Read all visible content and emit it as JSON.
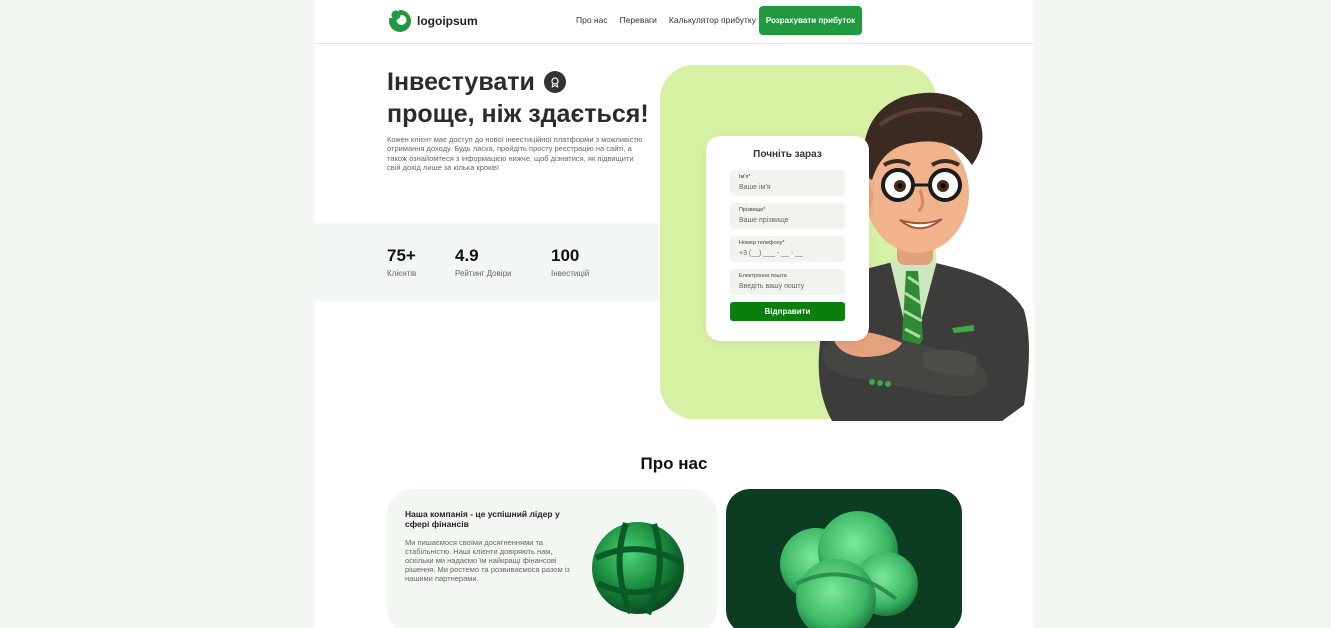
{
  "header": {
    "logo_text": "logoipsum",
    "nav": [
      "Про нас",
      "Переваги",
      "Калькулятор прибутку"
    ],
    "cta_label": "Розрахувати прибуток"
  },
  "hero": {
    "title_line1": "Інвестувати",
    "title_line2": "проще, ніж здається!",
    "description": "Кожен клієнт має доступ до нової інвестиційної платформи з можливістю отримання доходу. Будь ласка, пройдіть просту реєстрацію на сайті, а також ознайомтеся з інформацією нижче, щоб дізнатися, як підвищити свій дохід лише за кілька кроків!"
  },
  "stats": [
    {
      "value": "75+",
      "label": "Клієнтів"
    },
    {
      "value": "4.9",
      "label": "Рейтинг Довіри"
    },
    {
      "value": "100",
      "label": "Інвестицій"
    }
  ],
  "form": {
    "title": "Почніть зараз",
    "fields": [
      {
        "label": "Ім'я*",
        "placeholder": "Ваше ім'я"
      },
      {
        "label": "Прізвище*",
        "placeholder": "Ваше прізвище"
      },
      {
        "label": "Номер телефону*",
        "placeholder": "+3 (__) ___ - __ - __"
      },
      {
        "label": "Електронна пошта",
        "placeholder": "Введіть вашу пошту"
      }
    ],
    "submit_label": "Відправити"
  },
  "about": {
    "title": "Про нас",
    "card_title": "Наша компанія - це успішний лідер у сфері фінансів",
    "card_text": "Ми пишаємося своїми досягненнями та стабільністю. Наші клієнти довіряють нам, оскільки ми надаємо їм найкращі фінансові рішення. Ми ростемо та розвиваємося разом із нашими партнерами."
  },
  "colors": {
    "accent": "#1f9a3e",
    "panel": "#d6f0a4",
    "submit": "#0b7f0b",
    "dark_card": "#0c3d22"
  }
}
